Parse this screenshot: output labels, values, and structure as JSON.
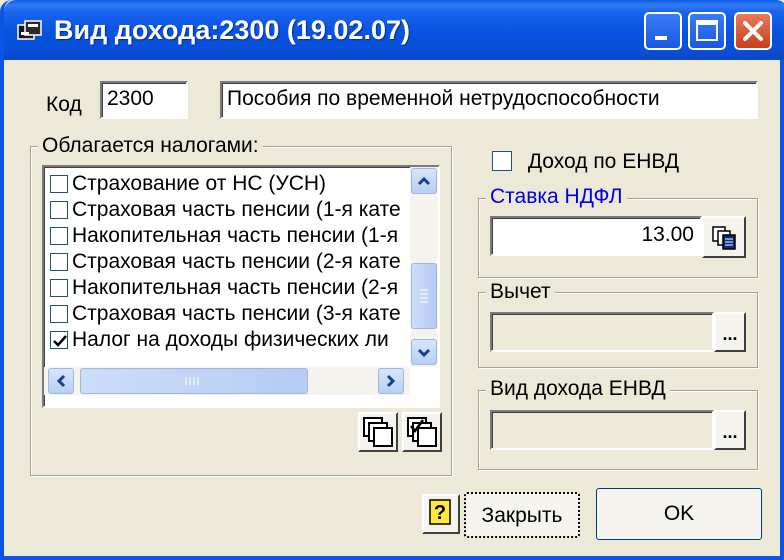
{
  "window": {
    "title": "Вид дохода:2300 (19.02.07)",
    "accent": "#0a55e6"
  },
  "code": {
    "label": "Код",
    "value": "2300",
    "name": "Пособия по временной нетрудоспособности"
  },
  "taxes": {
    "title": "Облагается налогами:",
    "items": [
      {
        "label": "Страхование от НС (УСН)",
        "checked": false
      },
      {
        "label": "Страховая часть пенсии (1-я кате",
        "checked": false
      },
      {
        "label": "Накопительная часть пенсии (1-я",
        "checked": false
      },
      {
        "label": "Страховая часть пенсии (2-я кате",
        "checked": false
      },
      {
        "label": "Накопительная часть пенсии (2-я",
        "checked": false
      },
      {
        "label": "Страховая часть пенсии (3-я кате",
        "checked": false
      },
      {
        "label": "Налог на доходы физических ли",
        "checked": true
      }
    ]
  },
  "envd": {
    "label": "Доход по ЕНВД",
    "checked": false
  },
  "ndfl": {
    "title": "Ставка НДФЛ",
    "value": "13.00",
    "title_color": "#0000e0"
  },
  "deduction": {
    "title": "Вычет",
    "value": "",
    "button": "..."
  },
  "envd_income": {
    "title": "Вид дохода ЕНВД",
    "value": "",
    "button": "..."
  },
  "footer": {
    "help_icon": "?",
    "close_label": "Закрыть",
    "ok_label": "OK"
  }
}
